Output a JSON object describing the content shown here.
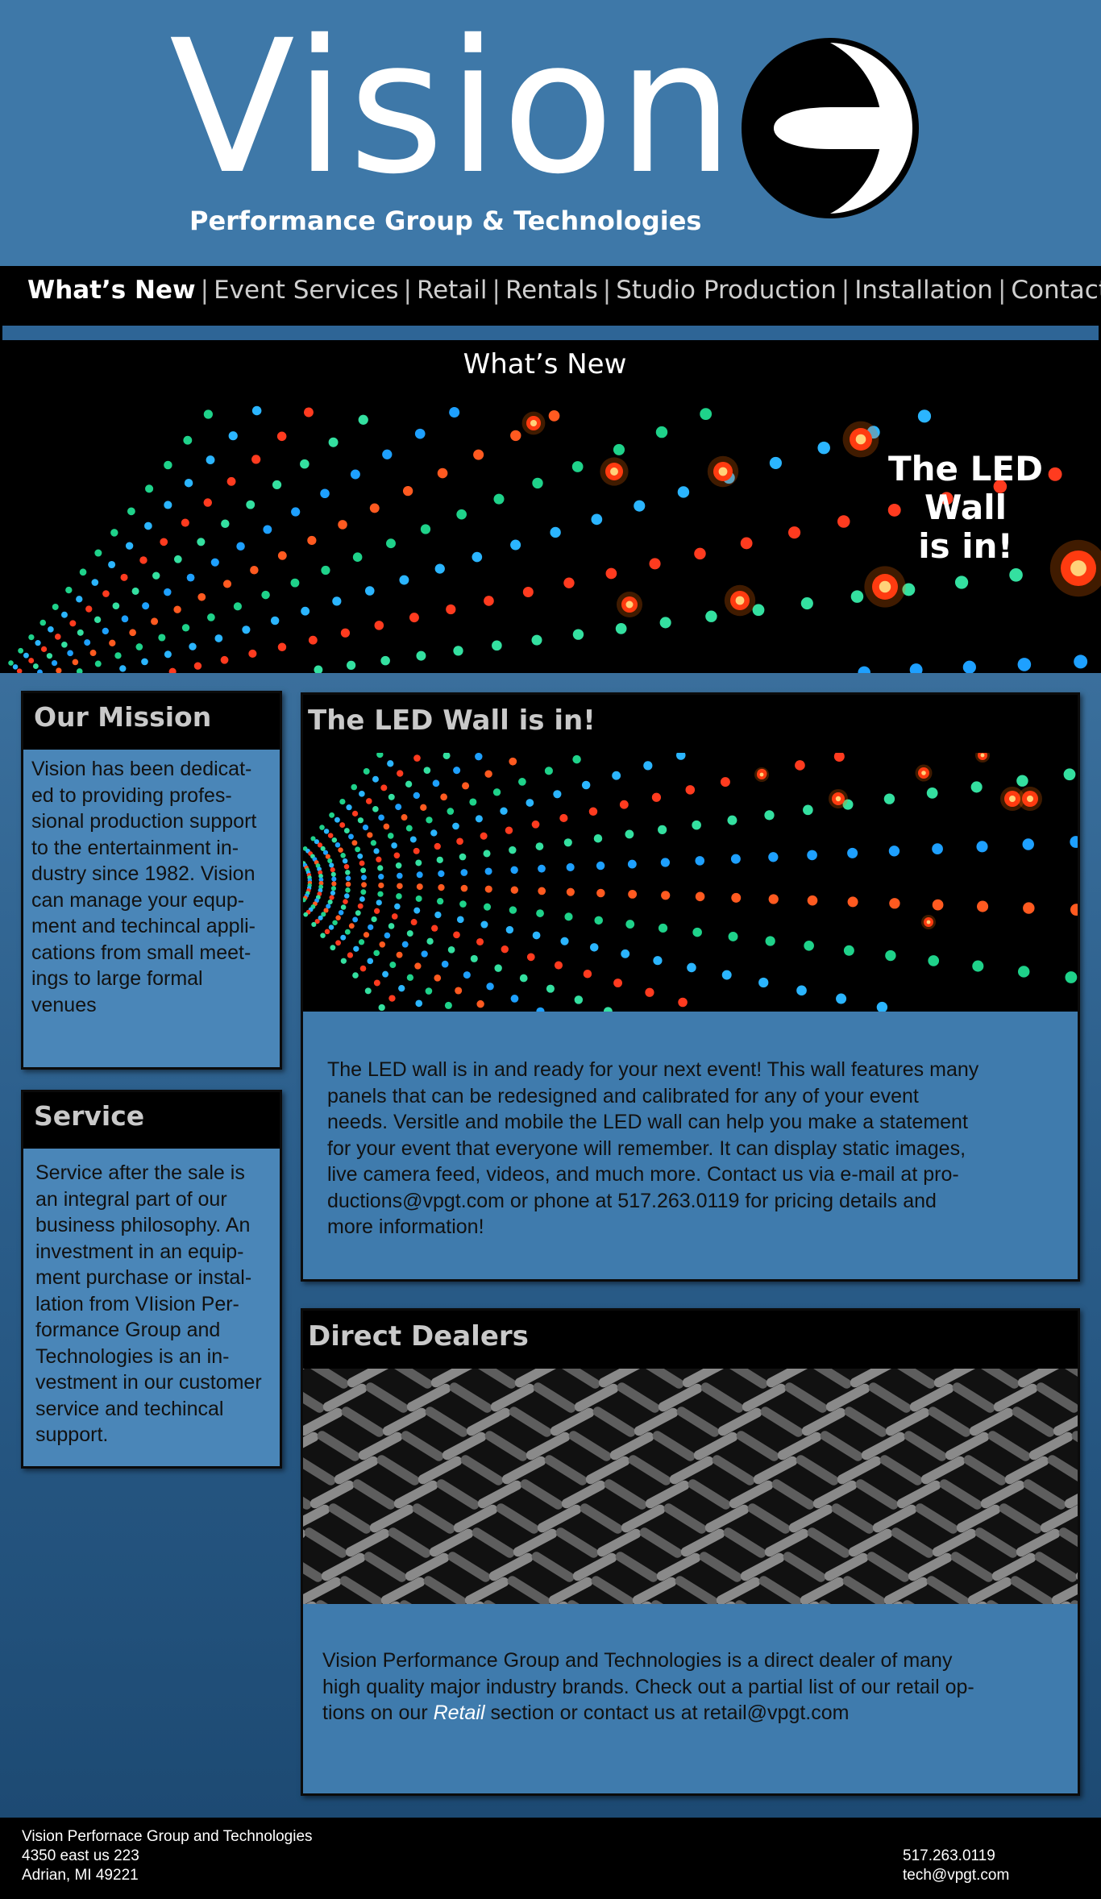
{
  "header": {
    "logo_word": "Vision",
    "logo_subtitle": "Performance Group & Technologies"
  },
  "nav": {
    "items": [
      {
        "label": "What’s New",
        "active": true
      },
      {
        "label": "Event Services"
      },
      {
        "label": "Retail"
      },
      {
        "label": "Rentals"
      },
      {
        "label": "Studio Production"
      },
      {
        "label": "Installation"
      },
      {
        "label": "Contact Us"
      }
    ],
    "separator": "|"
  },
  "banner": {
    "title": "What’s New",
    "hero_line1": "The LED Wall",
    "hero_line2": "is in!"
  },
  "mission": {
    "title": "Our Mission",
    "lines": [
      "Vision has been dedicat-",
      "ed to providing profes-",
      "sional production support",
      "to the entertainment in-",
      "dustry since 1982. Vision",
      "can manage your equp-",
      "ment and techincal appli-",
      "cations from small meet-",
      "ings to large formal",
      "venues"
    ]
  },
  "service": {
    "title": "Service",
    "lines": [
      "Service after the sale is",
      "an integral part of our",
      "business philosophy. An",
      "investment in an equip-",
      "ment purchase or instal-",
      "lation from VIision Per-",
      "formance Group and",
      "Technologies is an in-",
      "vestment in our customer",
      "service and techincal",
      "support."
    ]
  },
  "led_panel": {
    "title": "The LED Wall is in!",
    "lines": [
      "The LED wall is in and ready for your next event! This wall features many",
      "panels that can be redesigned and calibrated for any of your event",
      "needs. Versitle and mobile the LED wall can help you make a statement",
      "for your event that everyone will remember. It can display static images,",
      "live camera feed, videos, and much more. Contact us via e-mail at pro-",
      "ductions@vpgt.com or phone at 517.263.0119 for pricing details and",
      "more information!"
    ]
  },
  "dealers_panel": {
    "title": "Direct Dealers",
    "line1": "Vision Performance Group and Technologies is a direct dealer of many",
    "line2": "high quality major industry brands. Check out a partial list of our retail op-",
    "line3_pre": "tions on our ",
    "line3_link": "Retail",
    "line3_post": " section or contact us at retail@vpgt.com"
  },
  "footer": {
    "company": "Vision Perfornace Group and Technologies",
    "street": "4350 east us 223",
    "city": "Adrian, MI 49221",
    "phone": "517.263.0119",
    "email": "tech@vpgt.com"
  },
  "colors": {
    "header_bg": "#3e78a8",
    "panel_bg": "#3f7bad",
    "sidebox_bg": "#4a86b8",
    "nav_bg": "#000000"
  }
}
